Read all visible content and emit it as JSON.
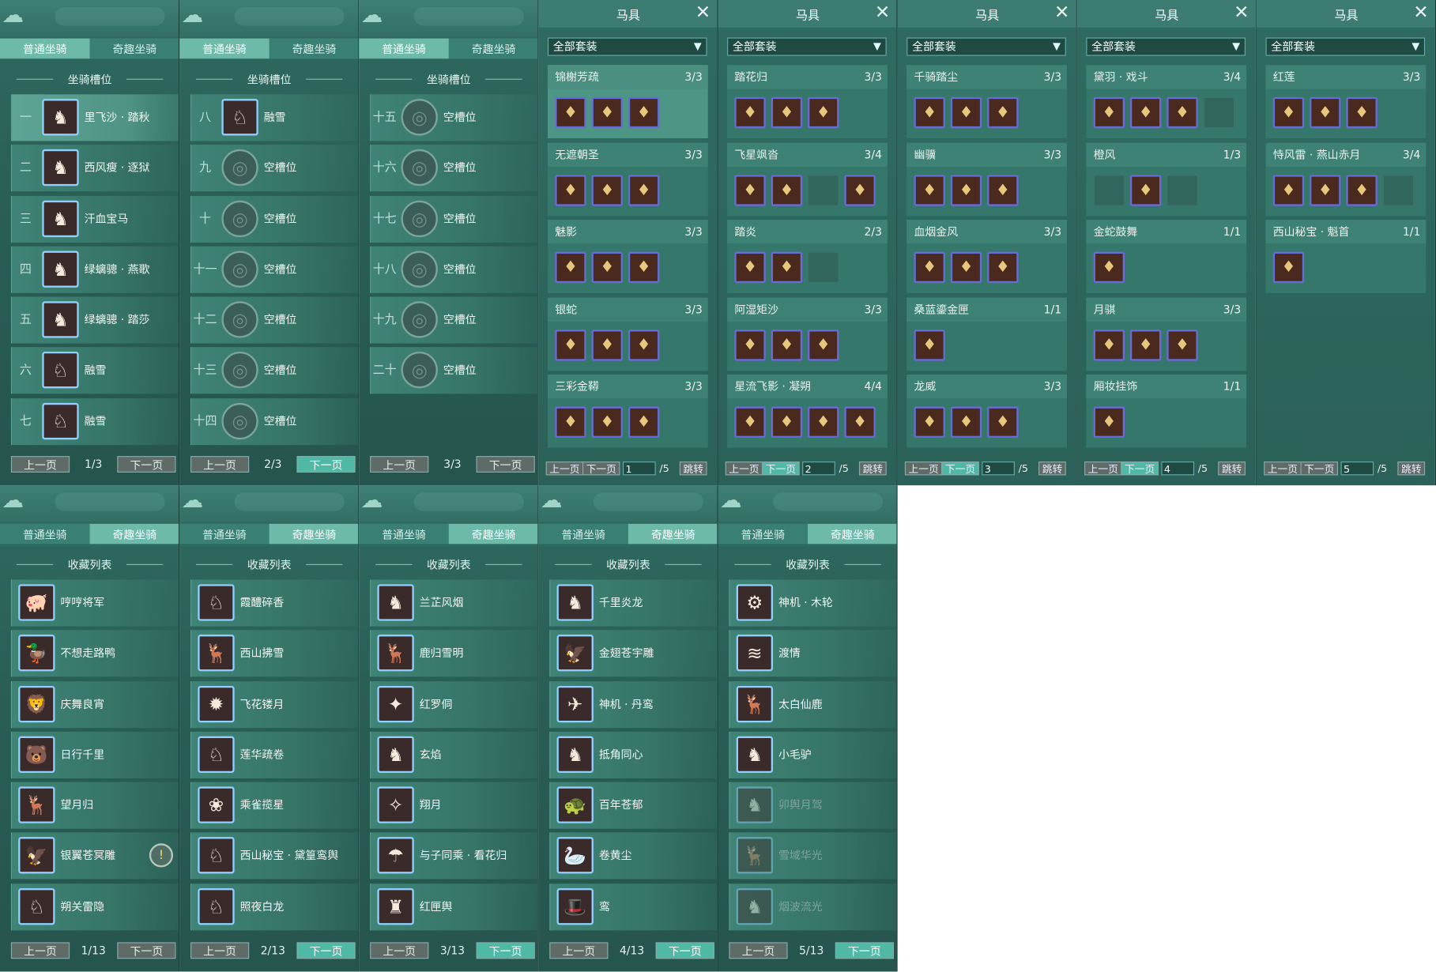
{
  "tabs": {
    "normal": "普通坐骑",
    "fun": "奇趣坐骑"
  },
  "slot_title": "坐骑槽位",
  "collect_title": "收藏列表",
  "pager": {
    "prev": "上一页",
    "next": "下一页"
  },
  "slot_panels": [
    {
      "page": "1/3",
      "rows": [
        {
          "num": "一",
          "name": "里飞沙 · 踏秋"
        },
        {
          "num": "二",
          "name": "西风瘦 · 逐狱"
        },
        {
          "num": "三",
          "name": "汗血宝马"
        },
        {
          "num": "四",
          "name": "绿螭骢 · 燕歌"
        },
        {
          "num": "五",
          "name": "绿螭骢 · 踏莎"
        },
        {
          "num": "六",
          "name": "融雪"
        },
        {
          "num": "七",
          "name": "融雪"
        }
      ]
    },
    {
      "page": "2/3",
      "rows": [
        {
          "num": "八",
          "name": "融雪"
        },
        {
          "num": "九",
          "name": "空槽位"
        },
        {
          "num": "十",
          "name": "空槽位"
        },
        {
          "num": "十一",
          "name": "空槽位"
        },
        {
          "num": "十二",
          "name": "空槽位"
        },
        {
          "num": "十三",
          "name": "空槽位"
        },
        {
          "num": "十四",
          "name": "空槽位"
        }
      ]
    },
    {
      "page": "3/3",
      "rows": [
        {
          "num": "十五",
          "name": "空槽位"
        },
        {
          "num": "十六",
          "name": "空槽位"
        },
        {
          "num": "十七",
          "name": "空槽位"
        },
        {
          "num": "十八",
          "name": "空槽位"
        },
        {
          "num": "十九",
          "name": "空槽位"
        },
        {
          "num": "二十",
          "name": "空槽位"
        },
        {
          "num": "",
          "name": ""
        }
      ]
    }
  ],
  "equip": {
    "title": "马具",
    "filter": "全部套装",
    "jump": "跳转",
    "total": "/5",
    "pages": [
      {
        "page": "1",
        "sets": [
          {
            "name": "锦榭芳疏",
            "count": "3/3",
            "slots": 3
          },
          {
            "name": "无遮朝圣",
            "count": "3/3",
            "slots": 3
          },
          {
            "name": "魅影",
            "count": "3/3",
            "slots": 3
          },
          {
            "name": "银蛇",
            "count": "3/3",
            "slots": 3
          },
          {
            "name": "三彩金鞯",
            "count": "3/3",
            "slots": 3
          }
        ]
      },
      {
        "page": "2",
        "sets": [
          {
            "name": "踏花归",
            "count": "3/3",
            "slots": 3
          },
          {
            "name": "飞星飒沓",
            "count": "3/4",
            "slots": 4
          },
          {
            "name": "踏炎",
            "count": "2/3",
            "slots": 3
          },
          {
            "name": "阿湿矩沙",
            "count": "3/3",
            "slots": 3
          },
          {
            "name": "星流飞影 · 凝朔",
            "count": "4/4",
            "slots": 4
          }
        ]
      },
      {
        "page": "3",
        "sets": [
          {
            "name": "千骑踏尘",
            "count": "3/3",
            "slots": 3
          },
          {
            "name": "幽骥",
            "count": "3/3",
            "slots": 3
          },
          {
            "name": "血烟金风",
            "count": "3/3",
            "slots": 3
          },
          {
            "name": "桑蓝鎏金匣",
            "count": "1/1",
            "slots": 1
          },
          {
            "name": "龙威",
            "count": "3/3",
            "slots": 3
          }
        ]
      },
      {
        "page": "4",
        "sets": [
          {
            "name": "黛羽 · 戏斗",
            "count": "3/4",
            "slots": 4
          },
          {
            "name": "橙风",
            "count": "1/3",
            "slots": 3
          },
          {
            "name": "金蛇鼓舞",
            "count": "1/1",
            "slots": 1
          },
          {
            "name": "月骐",
            "count": "3/3",
            "slots": 3
          },
          {
            "name": "厢妆挂饰",
            "count": "1/1",
            "slots": 1
          }
        ]
      },
      {
        "page": "5",
        "sets": [
          {
            "name": "红莲",
            "count": "3/3",
            "slots": 3
          },
          {
            "name": "恃风雷 · 燕山赤月",
            "count": "3/4",
            "slots": 4
          },
          {
            "name": "西山秘宝 · 魁首",
            "count": "1/1",
            "slots": 1
          }
        ]
      }
    ]
  },
  "collect_panels": [
    {
      "page": "1/13",
      "rows": [
        "哼哼将军",
        "不想走路鸭",
        "庆舞良宵",
        "日行千里",
        "望月归",
        "银翼苍冥雕",
        "朔关雷隐"
      ]
    },
    {
      "page": "2/13",
      "rows": [
        "霞醴碎香",
        "西山拂雪",
        "飞花镂月",
        "莲华疏卷",
        "乘雀揽星",
        "西山秘宝 · 黛篁鸾舆",
        "照夜白龙"
      ]
    },
    {
      "page": "3/13",
      "rows": [
        "兰芷风烟",
        "鹿归雪明",
        "红罗侗",
        "玄焰",
        "翔月",
        "与子同乘 · 看花归",
        "红匣舆"
      ]
    },
    {
      "page": "4/13",
      "rows": [
        "千里炎龙",
        "金翅苍宇雕",
        "神机 · 丹鸾",
        "抵角同心",
        "百年苍郁",
        "卷黄尘",
        "鸾"
      ]
    },
    {
      "page": "5/13",
      "rows": [
        "神机 · 木轮",
        "渡情",
        "太白仙鹿",
        "小毛驴",
        "卯舆月驾",
        "雪域华光",
        "烟波流光"
      ]
    }
  ]
}
